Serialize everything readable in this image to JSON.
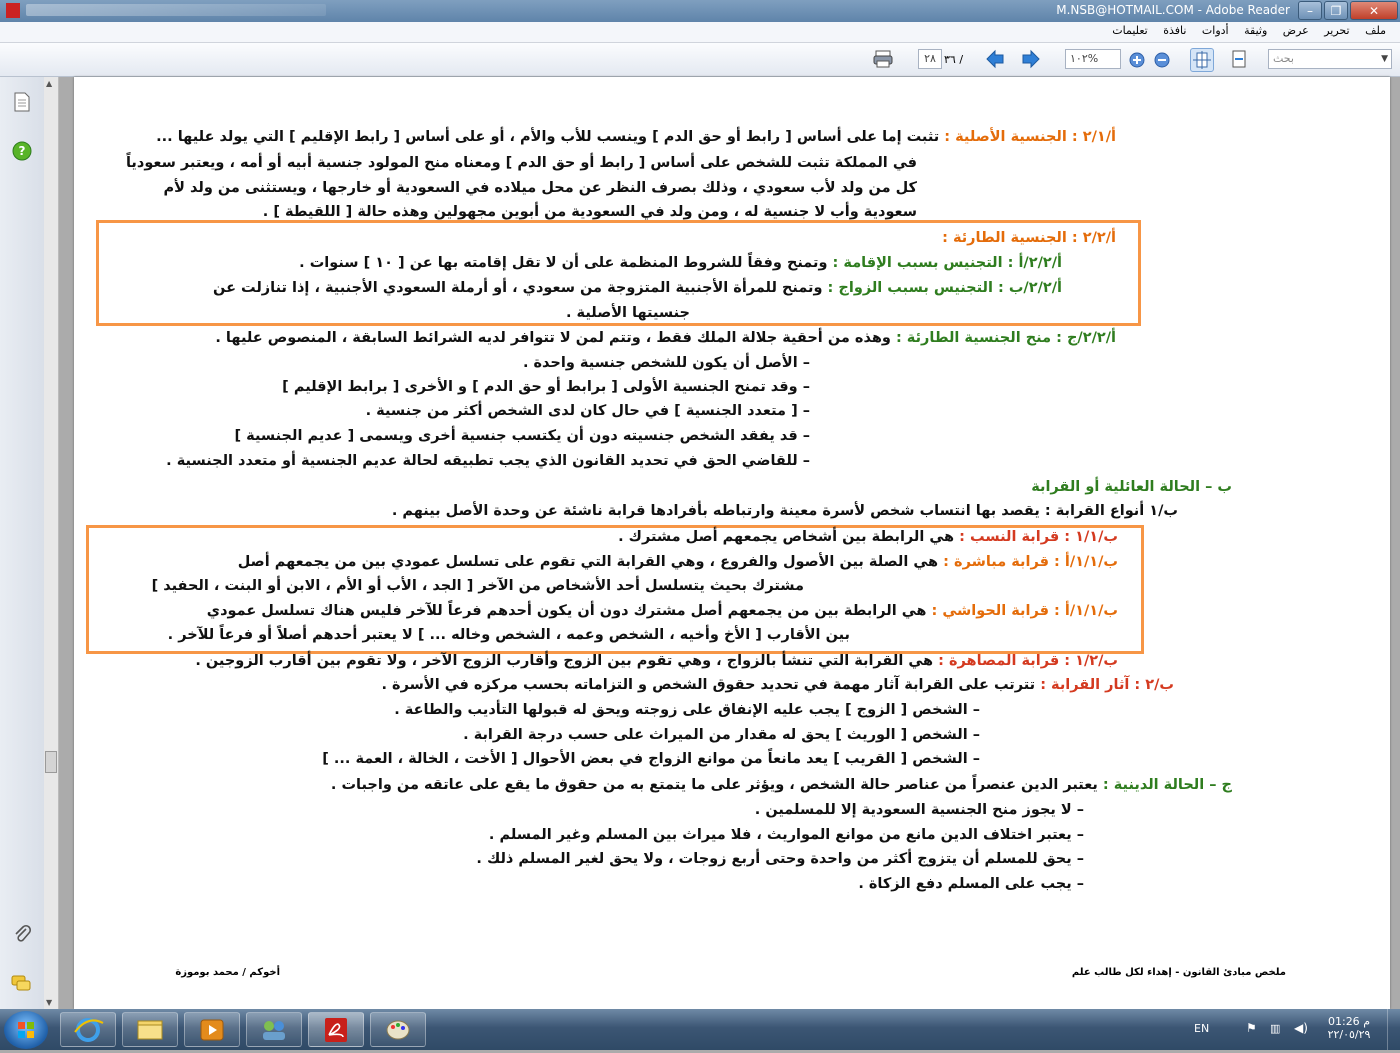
{
  "window": {
    "title": "M.NSB@HOTMAIL.COM - Adobe Reader"
  },
  "menu": {
    "items": [
      "ملف",
      "تحرير",
      "عرض",
      "وثيقة",
      "أدوات",
      "نافذة",
      "تعليمات"
    ]
  },
  "toolbar": {
    "current_page": "٢٨",
    "total_pages": "٣٦",
    "zoom": "١٠٢%",
    "search_placeholder": "بحث"
  },
  "document": {
    "lines": [
      {
        "label": "أ/٢/١ : الجنسية الأصلية : ",
        "text": "تثبت إما على أساس [ رابط أو حق الدم ] وينسب للأب والأم ، أو على أساس [ رابط الإقليم ] التي يولد عليها ..."
      },
      {
        "label": "",
        "text": "في المملكة تثبت للشخص على أساس [ رابط أو حق الدم ] ومعناه منح المولود جنسية أبيه أو أمه ، ويعتبر سعودياً"
      },
      {
        "label": "",
        "text": "كل من ولد لأب سعودي ، وذلك بصرف النظر عن محل ميلاده في السعودية أو خارجها ، ويستثنى من ولد لأم"
      },
      {
        "label": "",
        "text": "سعودية وأب لا جنسية له ، ومن ولد في السعودية من أبوين مجهولين وهذه حالة [ اللقيطة ] ."
      },
      {
        "label": "أ/٢/٢ : الجنسية الطارئة :",
        "text": ""
      },
      {
        "label": "أ/٢/٢/أ : التجنيس بسبب الإقامة : ",
        "text": "وتمنح وفقاً للشروط المنظمة على أن لا تقل إقامته بها عن [ ١٠ ] سنوات ."
      },
      {
        "label": "أ/٢/٢/ب : التجنيس بسبب الزواج : ",
        "text": "وتمنح للمرأة الأجنبية المتزوجة من سعودي ، أو أرملة السعودي الأجنبية ، إذا تنازلت عن"
      },
      {
        "label": "",
        "text": "جنسيتها الأصلية ."
      },
      {
        "label": "أ/٢/٢/ج : منح الجنسية الطارئة : ",
        "text": "وهذه من أحقية جلالة الملك فقط ، وتتم لمن لا تتوافر لديه الشرائط السابقة ، المنصوص عليها ."
      },
      {
        "label": "",
        "text": "–    الأصل أن يكون للشخص جنسية واحدة ."
      },
      {
        "label": "",
        "text": "–    وقد تمنح الجنسية الأولى [ برابط أو حق الدم ] و الأخرى [ برابط الإقليم ]"
      },
      {
        "label": "",
        "text": "–    [ متعدد الجنسية ] في حال كان لدى الشخص أكثر من جنسية ."
      },
      {
        "label": "",
        "text": "–    قد يفقد الشخص جنسيته دون أن يكتسب جنسية أخرى ويسمى [ عديم الجنسية ]"
      },
      {
        "label": "",
        "text": "–    للقاضي الحق في تحديد القانون الذي يجب تطبيقه لحالة عديم الجنسية أو متعدد الجنسية ."
      },
      {
        "label": "ب – الحالة العائلية أو القرابة",
        "text": ""
      },
      {
        "label": "",
        "text": "ب/١ أنواع القرابة : يقصد بها انتساب شخص لأسرة معينة وارتباطه بأفرادها قرابة ناشئة عن وحدة الأصل بينهم ."
      },
      {
        "label": "ب/١/١ : قرابة النسب : ",
        "text": "هي الرابطة بين أشخاص يجمعهم أصل مشترك ."
      },
      {
        "label": "ب/١/١/أ : قرابة مباشرة : ",
        "text": "هي الصلة بين الأصول والفروع ، وهي القرابة التي تقوم على تسلسل عمودي بين من يجمعهم أصل"
      },
      {
        "label": "",
        "text": "مشترك بحيث يتسلسل أحد الأشخاص من الآخر [ الجد ، الأب أو الأم ، الابن أو البنت ، الحفيد ]"
      },
      {
        "label": "ب/١/١/أ : قرابة الحواشي : ",
        "text": "هي الرابطة بين من يجمعهم أصل مشترك دون أن يكون أحدهم فرعاً للآخر فليس هناك تسلسل عمودي"
      },
      {
        "label": "",
        "text": "بين الأقارب [ الأخ وأخيه ، الشخص وعمه ، الشخص وخاله ... ] لا يعتبر أحدهم أصلاً أو فرعاً للآخر ."
      },
      {
        "label": "ب/١/٢ : قرابة المصاهرة : ",
        "text": "هي القرابة التي تنشأ بالزواج ، وهي تقوم بين الزوج وأقارب الزوج الآخر ، ولا تقوم بين أقارب الزوجين ."
      },
      {
        "label": "ب/٢ : آثار القرابة : ",
        "text": "تترتب على القرابة آثار مهمة في تحديد حقوق الشخص و التزاماته بحسب مركزه في الأسرة ."
      },
      {
        "label": "",
        "text": "–    الشخص [ الزوج ] يجب عليه الإنفاق على زوجته ويحق له قبولها التأديب والطاعة ."
      },
      {
        "label": "",
        "text": "–    الشخص [ الوريث ] يحق له مقدار من الميراث على حسب درجة القرابة ."
      },
      {
        "label": "",
        "text": "–    الشخص [ القريب ] يعد مانعاً من موانع الزواج في بعض الأحوال [ الأخت ، الخالة ، العمة ... ]"
      },
      {
        "label": "ج – الحالة الدينية : ",
        "text": "يعتبر الدين عنصراً من عناصر حالة الشخص ، ويؤثر على ما يتمتع به من حقوق ما يقع على عاتقه من واجبات ."
      },
      {
        "label": "",
        "text": "–    لا يجوز منح الجنسية السعودية إلا للمسلمين ."
      },
      {
        "label": "",
        "text": "–    يعتبر اختلاف الدين مانع من موانع المواريث ، فلا ميراث بين المسلم وغير المسلم ."
      },
      {
        "label": "",
        "text": "–    يحق للمسلم أن يتزوج أكثر من واحدة وحتى أربع زوجات ، ولا يحق لغير المسلم ذلك ."
      },
      {
        "label": "",
        "text": "–    يجب على المسلم دفع الزكاة ."
      }
    ],
    "footer_right": "ملخص مبادئ القانون  -   إهداء لكل طالب علم",
    "footer_left": "أخوكم  /  محمد بوموزة"
  },
  "tray": {
    "lang": "EN",
    "time": "01:26 م",
    "date": "٢٢/٠٥/٢٩"
  },
  "colors": {
    "heading_orange": "#e46c0a",
    "heading_green": "#2f7d1f",
    "heading_red": "#d43a20",
    "box_border": "#f79646"
  }
}
